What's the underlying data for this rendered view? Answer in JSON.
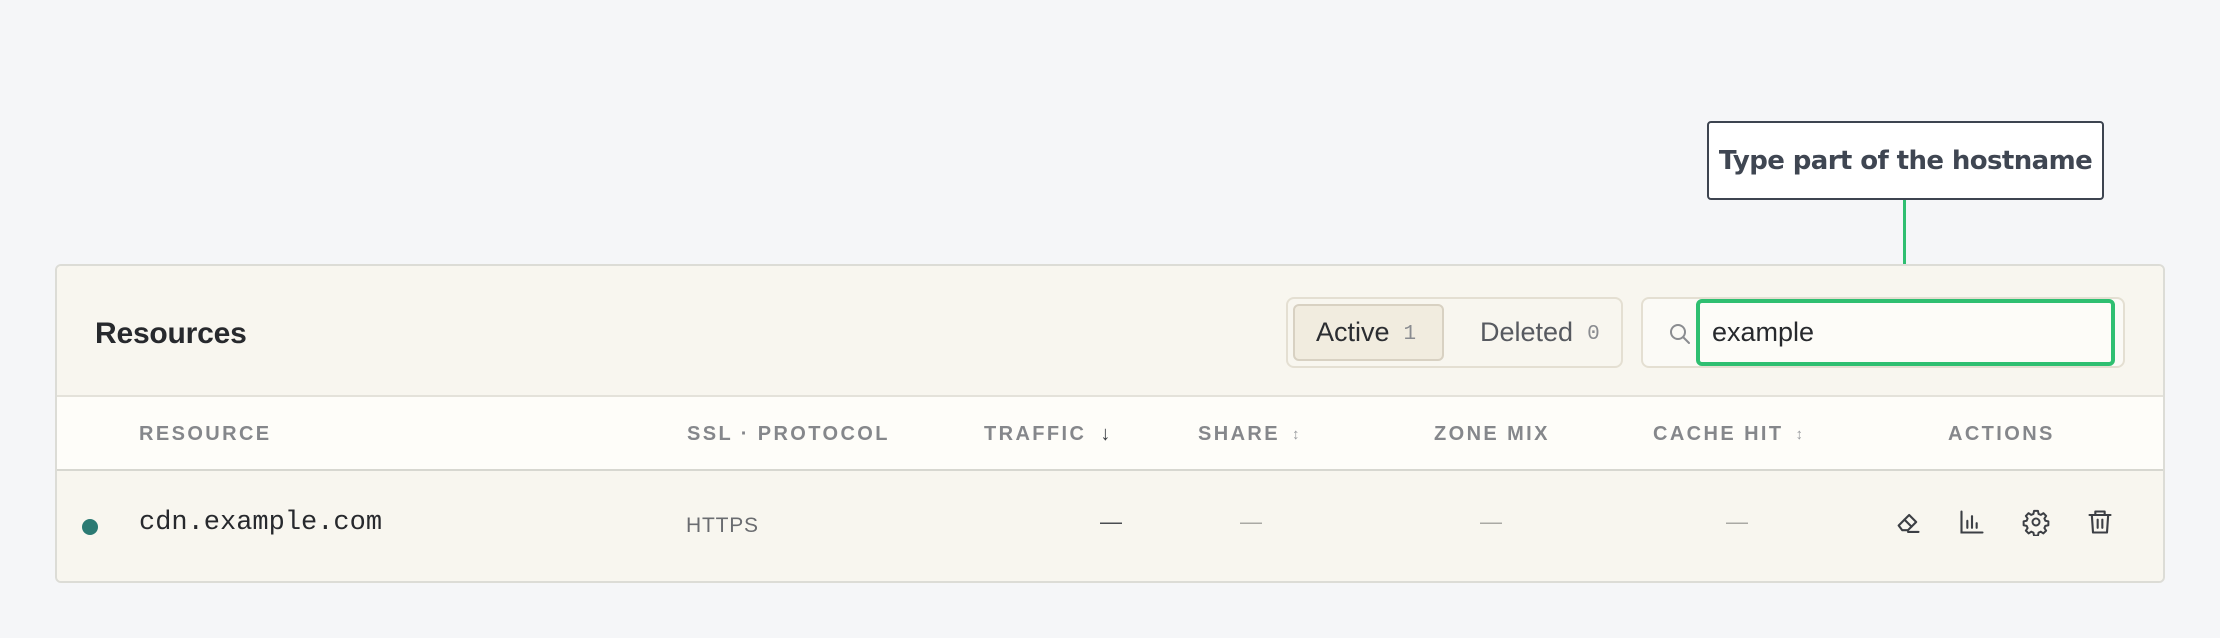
{
  "callout": {
    "text": "Type part of the hostname"
  },
  "panel": {
    "title": "Resources",
    "tabs": [
      {
        "label": "Active",
        "count": "1"
      },
      {
        "label": "Deleted",
        "count": "0"
      }
    ],
    "search": {
      "value": "example"
    }
  },
  "table": {
    "columns": {
      "resource": "RESOURCE",
      "ssl": "SSL · PROTOCOL",
      "traffic": "TRAFFIC",
      "share": "SHARE",
      "zone_mix": "ZONE MIX",
      "cache_hit": "CACHE HIT",
      "actions": "ACTIONS"
    },
    "rows": [
      {
        "resource": "cdn.example.com",
        "ssl": "HTTPS",
        "traffic": "—",
        "share": "—",
        "zone_mix": "—",
        "cache_hit": "—",
        "status_color": "#2b7a73"
      }
    ]
  },
  "icons": [
    "search-icon",
    "eraser-icon",
    "bar-chart-icon",
    "gear-icon",
    "trash-icon",
    "sort-desc-icon",
    "sort-icon"
  ],
  "colors": {
    "accent": "#2fbf71",
    "status_active": "#2b7a73"
  }
}
